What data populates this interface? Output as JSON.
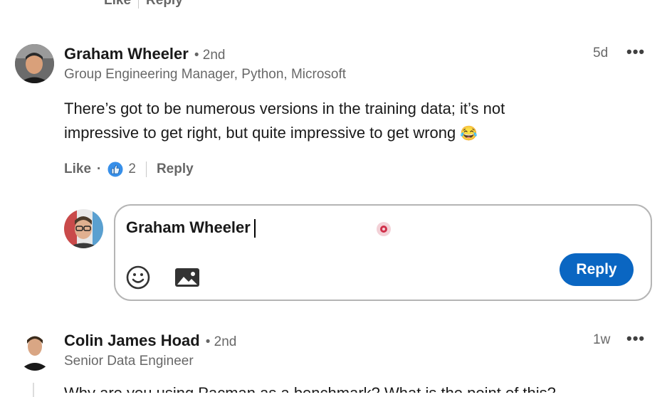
{
  "previous_comment": {
    "like_label": "Like",
    "reply_label": "Reply"
  },
  "comments": [
    {
      "author": "Graham Wheeler",
      "degree": "2nd",
      "headline": "Group Engineering Manager, Python, Microsoft",
      "time": "5d",
      "text_line1": "There’s got to be numerous versions in the training data; it’s not",
      "text_line2": "impressive to get right, but quite impressive to get wrong",
      "emoji": "😂",
      "like_label": "Like",
      "reaction_count": "2",
      "reply_label": "Reply"
    },
    {
      "author": "Colin James Hoad",
      "degree": "2nd",
      "headline": "Senior Data Engineer",
      "time": "1w",
      "text_partial": "Why are you using Pacman as a benchmark? What is the point of this?"
    }
  ],
  "reply_box": {
    "mention": "Graham Wheeler",
    "submit_label": "Reply"
  },
  "colors": {
    "accent": "#0a66c2",
    "record_dot": "#d0304a"
  },
  "icons": [
    "emoji-icon",
    "image-icon",
    "thumbs-up-reaction-icon",
    "overflow-menu-icon"
  ]
}
